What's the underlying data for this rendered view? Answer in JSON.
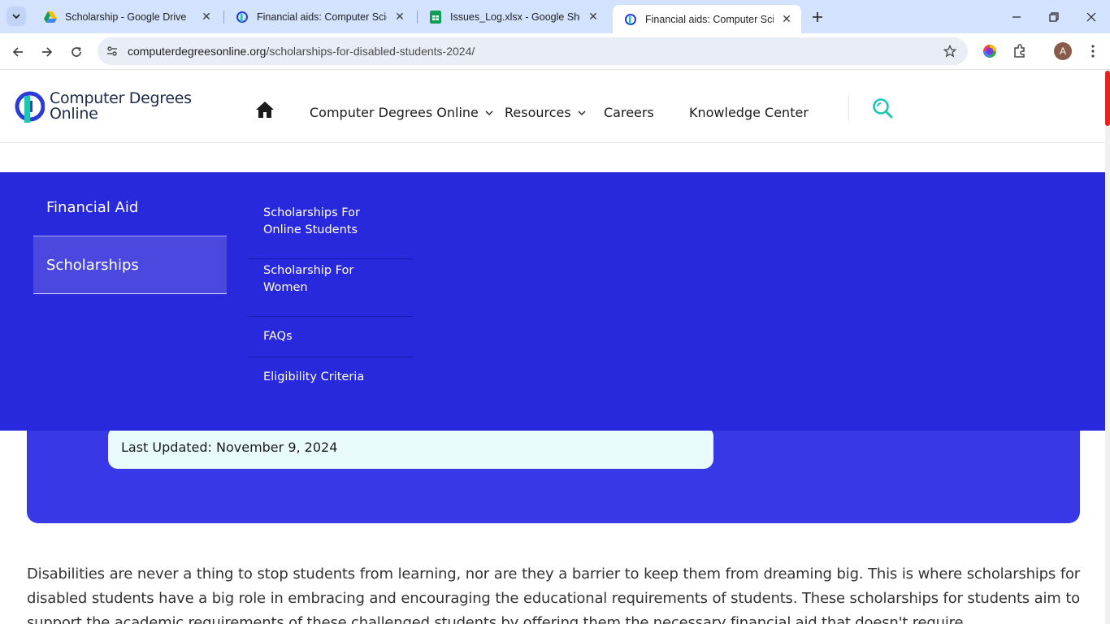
{
  "browser": {
    "tabs": [
      {
        "title": "Scholarship - Google Drive",
        "icon": "google-drive-icon",
        "active": false
      },
      {
        "title": "Financial aids: Computer Scienc",
        "icon": "site-favicon",
        "active": false
      },
      {
        "title": "Issues_Log.xlsx - Google Sheets",
        "icon": "google-sheets-icon",
        "active": false
      },
      {
        "title": "Financial aids: Computer Scienc",
        "icon": "site-favicon",
        "active": true
      }
    ],
    "url_domain": "computerdegreesonline.org",
    "url_path": "/scholarships-for-disabled-students-2024/",
    "profile_initial": "A"
  },
  "site": {
    "logo_line1": "Computer Degrees",
    "logo_line2": "Online",
    "nav": [
      {
        "label": "Computer Degrees Online",
        "has_dropdown": true
      },
      {
        "label": "Resources",
        "has_dropdown": true
      },
      {
        "label": "Careers",
        "has_dropdown": false
      },
      {
        "label": "Knowledge Center",
        "has_dropdown": false
      }
    ]
  },
  "mega_menu": {
    "categories": [
      "Financial Aid",
      "Scholarships"
    ],
    "selected_category": "Scholarships",
    "sub_items": [
      "Scholarships For Online Students",
      "Scholarship For Women",
      "FAQs",
      "Eligibility Criteria"
    ]
  },
  "article": {
    "last_updated": "Last Updated: November 9, 2024",
    "intro": "Disabilities are never a thing to stop students from learning, nor are they a barrier to keep them from dreaming big. This is where scholarships for disabled students have a big role in embracing and encouraging the educational requirements of students. These scholarships for students  aim to support the academic requirements of these challenged students by offering them the necessary financial aid that doesn't require"
  },
  "colors": {
    "mega_menu_bg": "#2828dd",
    "hero_bg": "#3838e6",
    "accent_teal": "#1cc6b3",
    "tab_strip": "#d3e3fd"
  }
}
